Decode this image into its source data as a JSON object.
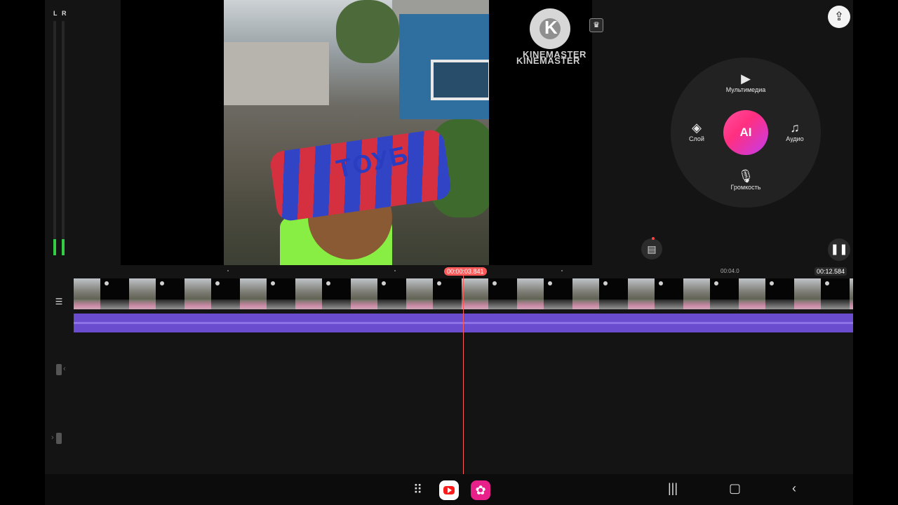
{
  "meters": {
    "left_label": "L",
    "right_label": "R",
    "left_level": 0.07,
    "right_level": 0.07
  },
  "preview": {
    "hat_text": "ТОУБ",
    "watermark": {
      "logo_letter": "K",
      "line1": "KINEMASTER",
      "line2": "KINEMASTER"
    },
    "premium_icon": "crown-icon"
  },
  "wheel": {
    "center_label": "AI",
    "top": {
      "label": "Мультимедиа",
      "icon": "media-play-icon"
    },
    "left": {
      "label": "Слой",
      "icon": "layers-icon"
    },
    "right": {
      "label": "Аудио",
      "icon": "music-note-icon"
    },
    "bottom": {
      "label": "Громкость",
      "icon": "microphone-icon"
    }
  },
  "controls": {
    "share_icon": "share-icon",
    "asset_store_icon": "asset-store-icon",
    "pause_icon": "pause-icon"
  },
  "timeline": {
    "current_time": "00:00:03.841",
    "mark_time": "00:04.0",
    "total_time": "00:12.584"
  },
  "colors": {
    "accent": "#ff5a5a",
    "audio_track": "#6a4ccf",
    "ai_gradient_start": "#ff4fa0",
    "ai_gradient_end": "#c33cf0",
    "meter": "#33cc44"
  },
  "navbar": {
    "apps_icon": "apps-grid-icon",
    "app1": "youtube-icon",
    "app2": "flower-app-icon",
    "recent_icon": "recent-apps-icon",
    "home_icon": "home-icon",
    "back_icon": "back-icon"
  }
}
